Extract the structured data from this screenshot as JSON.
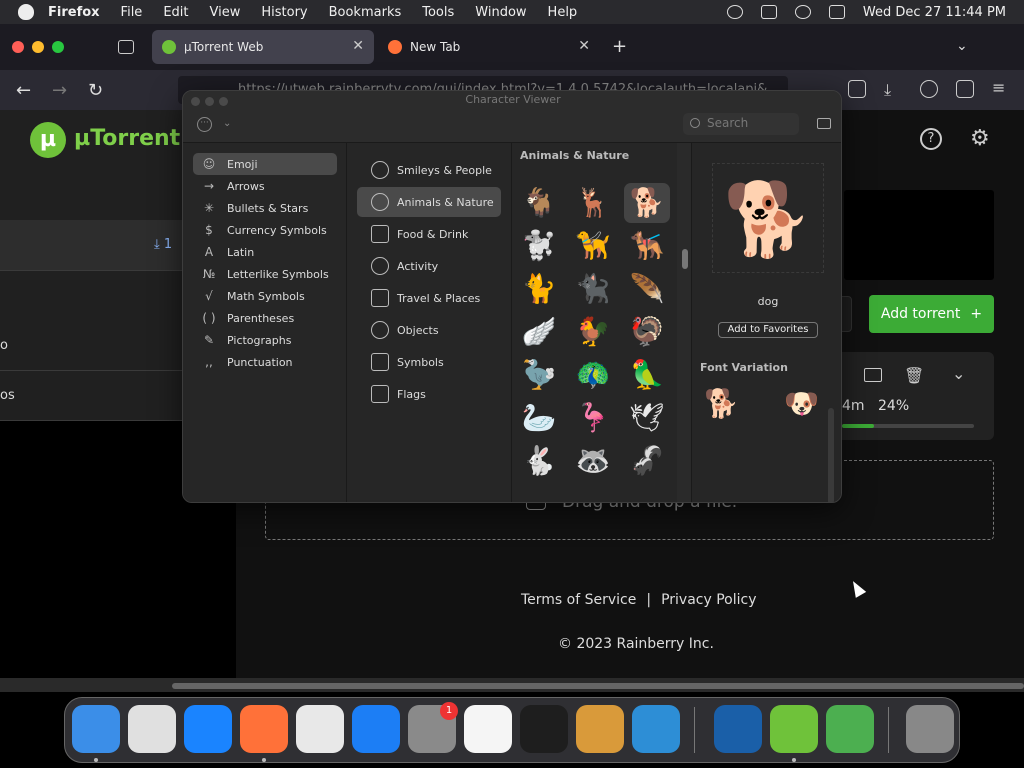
{
  "menubar": {
    "app": "Firefox",
    "items": [
      "File",
      "Edit",
      "View",
      "History",
      "Bookmarks",
      "Tools",
      "Window",
      "Help"
    ],
    "clock": "Wed Dec 27  11:44 PM"
  },
  "tabs": [
    {
      "title": "µTorrent Web",
      "active": true
    },
    {
      "title": "New Tab",
      "active": false
    }
  ],
  "url": "https://utweb.rainberrytv.com/gui/index.html?v=1.4.0.5742&localauth=localapi&",
  "utorrent": {
    "logo_letter": "µ",
    "title": "µTorrent Web",
    "left_rows": [
      {
        "text": "⤓ 1"
      },
      {
        "text": "o"
      },
      {
        "text": "os"
      }
    ],
    "add_torrent_label": "Add torrent",
    "torrent_time": "4m",
    "torrent_progress_text": "24%",
    "torrent_progress": 0.24,
    "dropzone_text": "Drag and drop a file.",
    "terms": "Terms of Service",
    "separator": "|",
    "privacy": "Privacy Policy",
    "copyright": "© 2023 Rainberry Inc."
  },
  "character_viewer": {
    "title": "Character Viewer",
    "search_placeholder": "Search",
    "categories": [
      {
        "glyph": "☺",
        "label": "Emoji",
        "selected": true
      },
      {
        "glyph": "→",
        "label": "Arrows"
      },
      {
        "glyph": "✳",
        "label": "Bullets & Stars"
      },
      {
        "glyph": "$",
        "label": "Currency Symbols"
      },
      {
        "glyph": "A",
        "label": "Latin"
      },
      {
        "glyph": "№",
        "label": "Letterlike Symbols"
      },
      {
        "glyph": "√",
        "label": "Math Symbols"
      },
      {
        "glyph": "( )",
        "label": "Parentheses"
      },
      {
        "glyph": "✎",
        "label": "Pictographs"
      },
      {
        "glyph": ",,",
        "label": "Punctuation"
      }
    ],
    "subcategories": [
      {
        "label": "Smileys & People"
      },
      {
        "label": "Animals & Nature",
        "selected": true
      },
      {
        "label": "Food & Drink"
      },
      {
        "label": "Activity"
      },
      {
        "label": "Travel & Places"
      },
      {
        "label": "Objects"
      },
      {
        "label": "Symbols"
      },
      {
        "label": "Flags"
      }
    ],
    "section_heading": "Animals & Nature",
    "emoji_rows": [
      [
        "🐐",
        "🦌",
        "🐕"
      ],
      [
        "🐩",
        "🦮",
        "🐕‍🦺"
      ],
      [
        "🐈",
        "🐈‍⬛",
        "🪶"
      ],
      [
        "🪽",
        "🐓",
        "🦃"
      ],
      [
        "🦤",
        "🦚",
        "🦜"
      ],
      [
        "🦢",
        "🦩",
        "🕊"
      ],
      [
        "🐇",
        "🦝",
        "🦨"
      ]
    ],
    "selected_emoji": "🐕",
    "selected_name": "dog",
    "add_favorites_label": "Add to Favorites",
    "font_variation_heading": "Font Variation",
    "font_variations": [
      "🐕",
      "🐶"
    ]
  },
  "dock": {
    "apps": [
      "Finder",
      "Launchpad",
      "Safari",
      "Firefox",
      "Chrome",
      "App Store",
      "System Settings",
      "TextEdit",
      "Terminal",
      "GarageBand",
      "VS Code",
      "Migration",
      "µTorrent",
      "Maps",
      "Trash"
    ],
    "badge": "1"
  },
  "colors": {
    "accent_green": "#3cab36",
    "panel_bg": "#262626",
    "selected_bg": "#4a4a4a"
  }
}
